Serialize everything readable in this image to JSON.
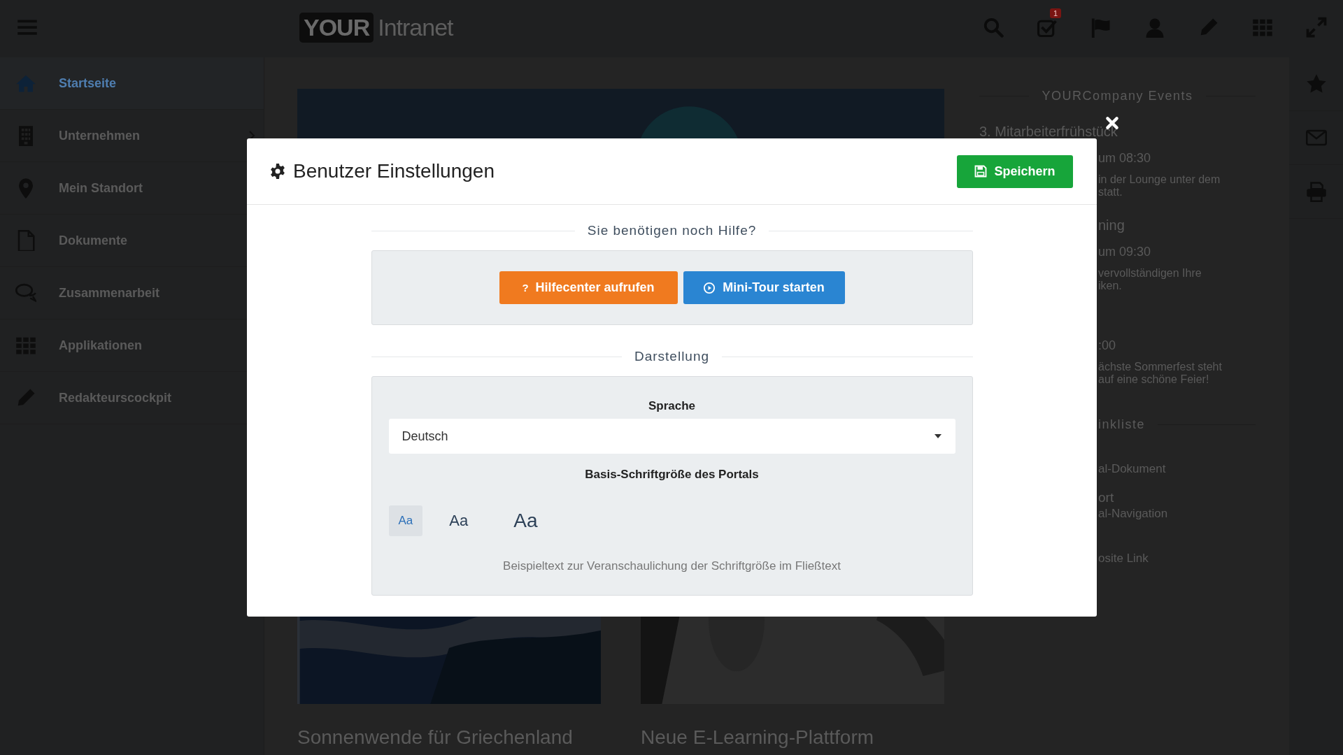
{
  "topbar": {
    "logo": {
      "mark": "YOUR",
      "text": "Intranet"
    },
    "icons": [
      {
        "kind": "search"
      },
      {
        "kind": "tasks",
        "badge": "1"
      },
      {
        "kind": "flag"
      },
      {
        "kind": "avatar"
      },
      {
        "kind": "pencil"
      },
      {
        "kind": "apps"
      },
      {
        "kind": "expand"
      }
    ]
  },
  "sidebar": {
    "items": [
      {
        "kind": "home",
        "label": "Startseite",
        "selected": true,
        "chevron": false
      },
      {
        "kind": "building",
        "label": "Unternehmen",
        "selected": false,
        "chevron": true
      },
      {
        "kind": "pin",
        "label": "Mein Standort",
        "selected": false,
        "chevron": false
      },
      {
        "kind": "document",
        "label": "Dokumente",
        "selected": false,
        "chevron": false
      },
      {
        "kind": "chat",
        "label": "Zusammenarbeit",
        "selected": false,
        "chevron": false
      },
      {
        "kind": "apps",
        "label": "Applikationen",
        "selected": false,
        "chevron": false
      },
      {
        "kind": "pencil",
        "label": "Redakteurscockpit",
        "selected": false,
        "chevron": false
      }
    ]
  },
  "content": {
    "articles": [
      {
        "kind": "picture",
        "title": "Sonnenwende für Griechenland"
      },
      {
        "kind": "picture",
        "title": "Neue E-Learning-Plattform"
      }
    ]
  },
  "events_panel": {
    "title": "YOURCompany Events",
    "events": [
      {
        "heading": "3. Mitarbeiterfrühstück",
        "time": "um 08:30",
        "lines": [
          "in der Lounge unter dem",
          "statt."
        ]
      },
      {
        "heading": "ning",
        "time": "um 09:30",
        "lines": [
          "vervollständigen Ihre",
          "iken."
        ]
      },
      {
        "time": ":00",
        "lines": [
          "ächste Sommerfest steht",
          "auf eine schöne Feier!"
        ]
      }
    ],
    "links_title": "inkliste",
    "links": [
      {
        "subtitle": "al-Dokument"
      },
      {
        "title": "ort",
        "subtitle": "al-Navigation"
      },
      {
        "subtitle": "osite Link"
      }
    ]
  },
  "right_rail": {
    "icons": [
      {
        "kind": "star"
      },
      {
        "kind": "mail"
      },
      {
        "kind": "print"
      }
    ]
  },
  "modal": {
    "title": "Benutzer Einstellungen",
    "save_button": "Speichern",
    "help_section": {
      "title": "Sie benötigen noch Hilfe?",
      "buttons": [
        {
          "kind": "help",
          "label": "Hilfecenter aufrufen",
          "icon_text": "?"
        },
        {
          "kind": "tour",
          "label": "Mini-Tour starten"
        }
      ]
    },
    "display_section": {
      "title": "Darstellung",
      "language_label": "Sprache",
      "language_value": "Deutsch",
      "font_size_label": "Basis-Schriftgröße des Portals",
      "font_sizes": [
        {
          "kind": "small",
          "label": "Aa",
          "selected": true
        },
        {
          "kind": "medium",
          "label": "Aa",
          "selected": false
        },
        {
          "kind": "large",
          "label": "Aa",
          "selected": false
        }
      ],
      "sample_text": "Beispieltext zur Veranschaulichung der Schriftgröße im Fließtext"
    }
  }
}
